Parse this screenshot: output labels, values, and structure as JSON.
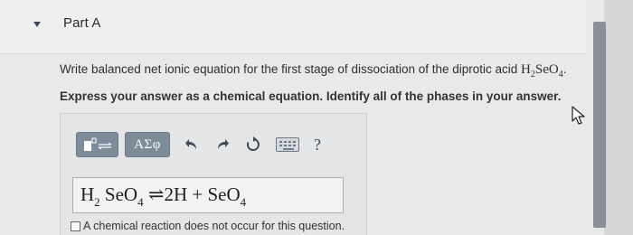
{
  "part": {
    "title": "Part A",
    "question_prefix": "Write balanced net ionic equation for the first stage of dissociation of the diprotic acid ",
    "acid_formula": {
      "h": "H",
      "h_sub": "2",
      "se": "SeO",
      "o_sub": "4"
    },
    "question_suffix": ".",
    "instruction": "Express your answer as a chemical equation. Identify all of the phases in your answer."
  },
  "toolbar": {
    "templates_icon": "templates-icon",
    "symbols_label": "ΑΣφ",
    "undo_icon": "undo-icon",
    "redo_icon": "redo-icon",
    "reset_icon": "reset-icon",
    "keyboard_icon": "keyboard-icon",
    "help_label": "?"
  },
  "answer": {
    "reactant_h": "H",
    "reactant_h_sub": "2",
    "reactant_seo": "SeO",
    "reactant_seo_sub": "4",
    "arrow": "⇌",
    "product_h": "2H",
    "plus": "+",
    "product_seo": "SeO",
    "product_seo_sub": "4"
  },
  "no_reaction_label": "A chemical reaction does not occur for this question.",
  "colors": {
    "toolbar_button": "#7e8b99",
    "icon": "#3d4a59",
    "background": "#e8e9e9"
  }
}
